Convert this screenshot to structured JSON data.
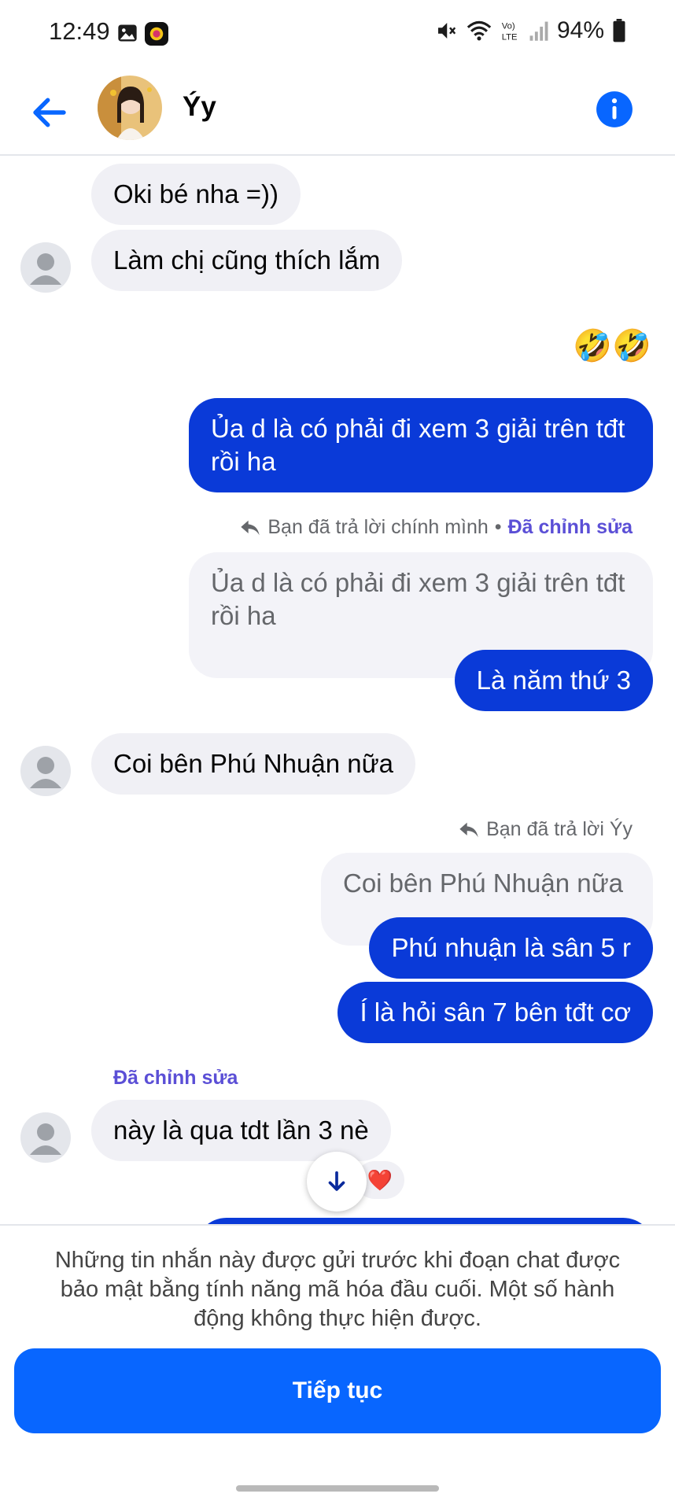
{
  "status_bar": {
    "time": "12:49",
    "battery": "94%"
  },
  "header": {
    "contact_name": "Ýy"
  },
  "messages": {
    "m1": "Oki bé nha =))",
    "m2": "Làm chị cũng thích lắm",
    "m3_emoji": "🤣🤣",
    "m4": "Ủa d là có phải đi xem 3 giải trên tđt rồi ha",
    "m5_reply_meta": "Bạn đã trả lời chính mình",
    "m5_edited": "Đã chỉnh sửa",
    "m5_quote": "Ủa d là có phải đi xem 3 giải trên tđt rồi ha",
    "m5": "Là năm thứ 3",
    "m6": "Coi bên Phú Nhuận nữa",
    "m7_reply_meta": "Bạn đã trả lời Ýy",
    "m7_quote": "Coi bên Phú Nhuận nữa",
    "m7": "Phú nhuận là sân 5 r",
    "m8": "Í là hỏi sân 7 bên tđt cơ",
    "m9_edited": "Đã chỉnh sửa",
    "m9": "này là qua tdt lần 3 nè",
    "m9_reaction": "❤️"
  },
  "bottom": {
    "notice": "Những tin nhắn này được gửi trước khi đoạn chat được bảo mật bằng tính năng mã hóa đầu cuối. Một số hành động không thực hiện được.",
    "continue_label": "Tiếp tục"
  },
  "icons": {
    "back": "back-arrow-icon",
    "info": "info-icon",
    "reply": "reply-icon",
    "scroll_down": "arrow-down-icon"
  },
  "colors": {
    "accent": "#0866ff",
    "outgoing_bubble": "#0a3ad8",
    "edited_label": "#5b4fd6"
  }
}
